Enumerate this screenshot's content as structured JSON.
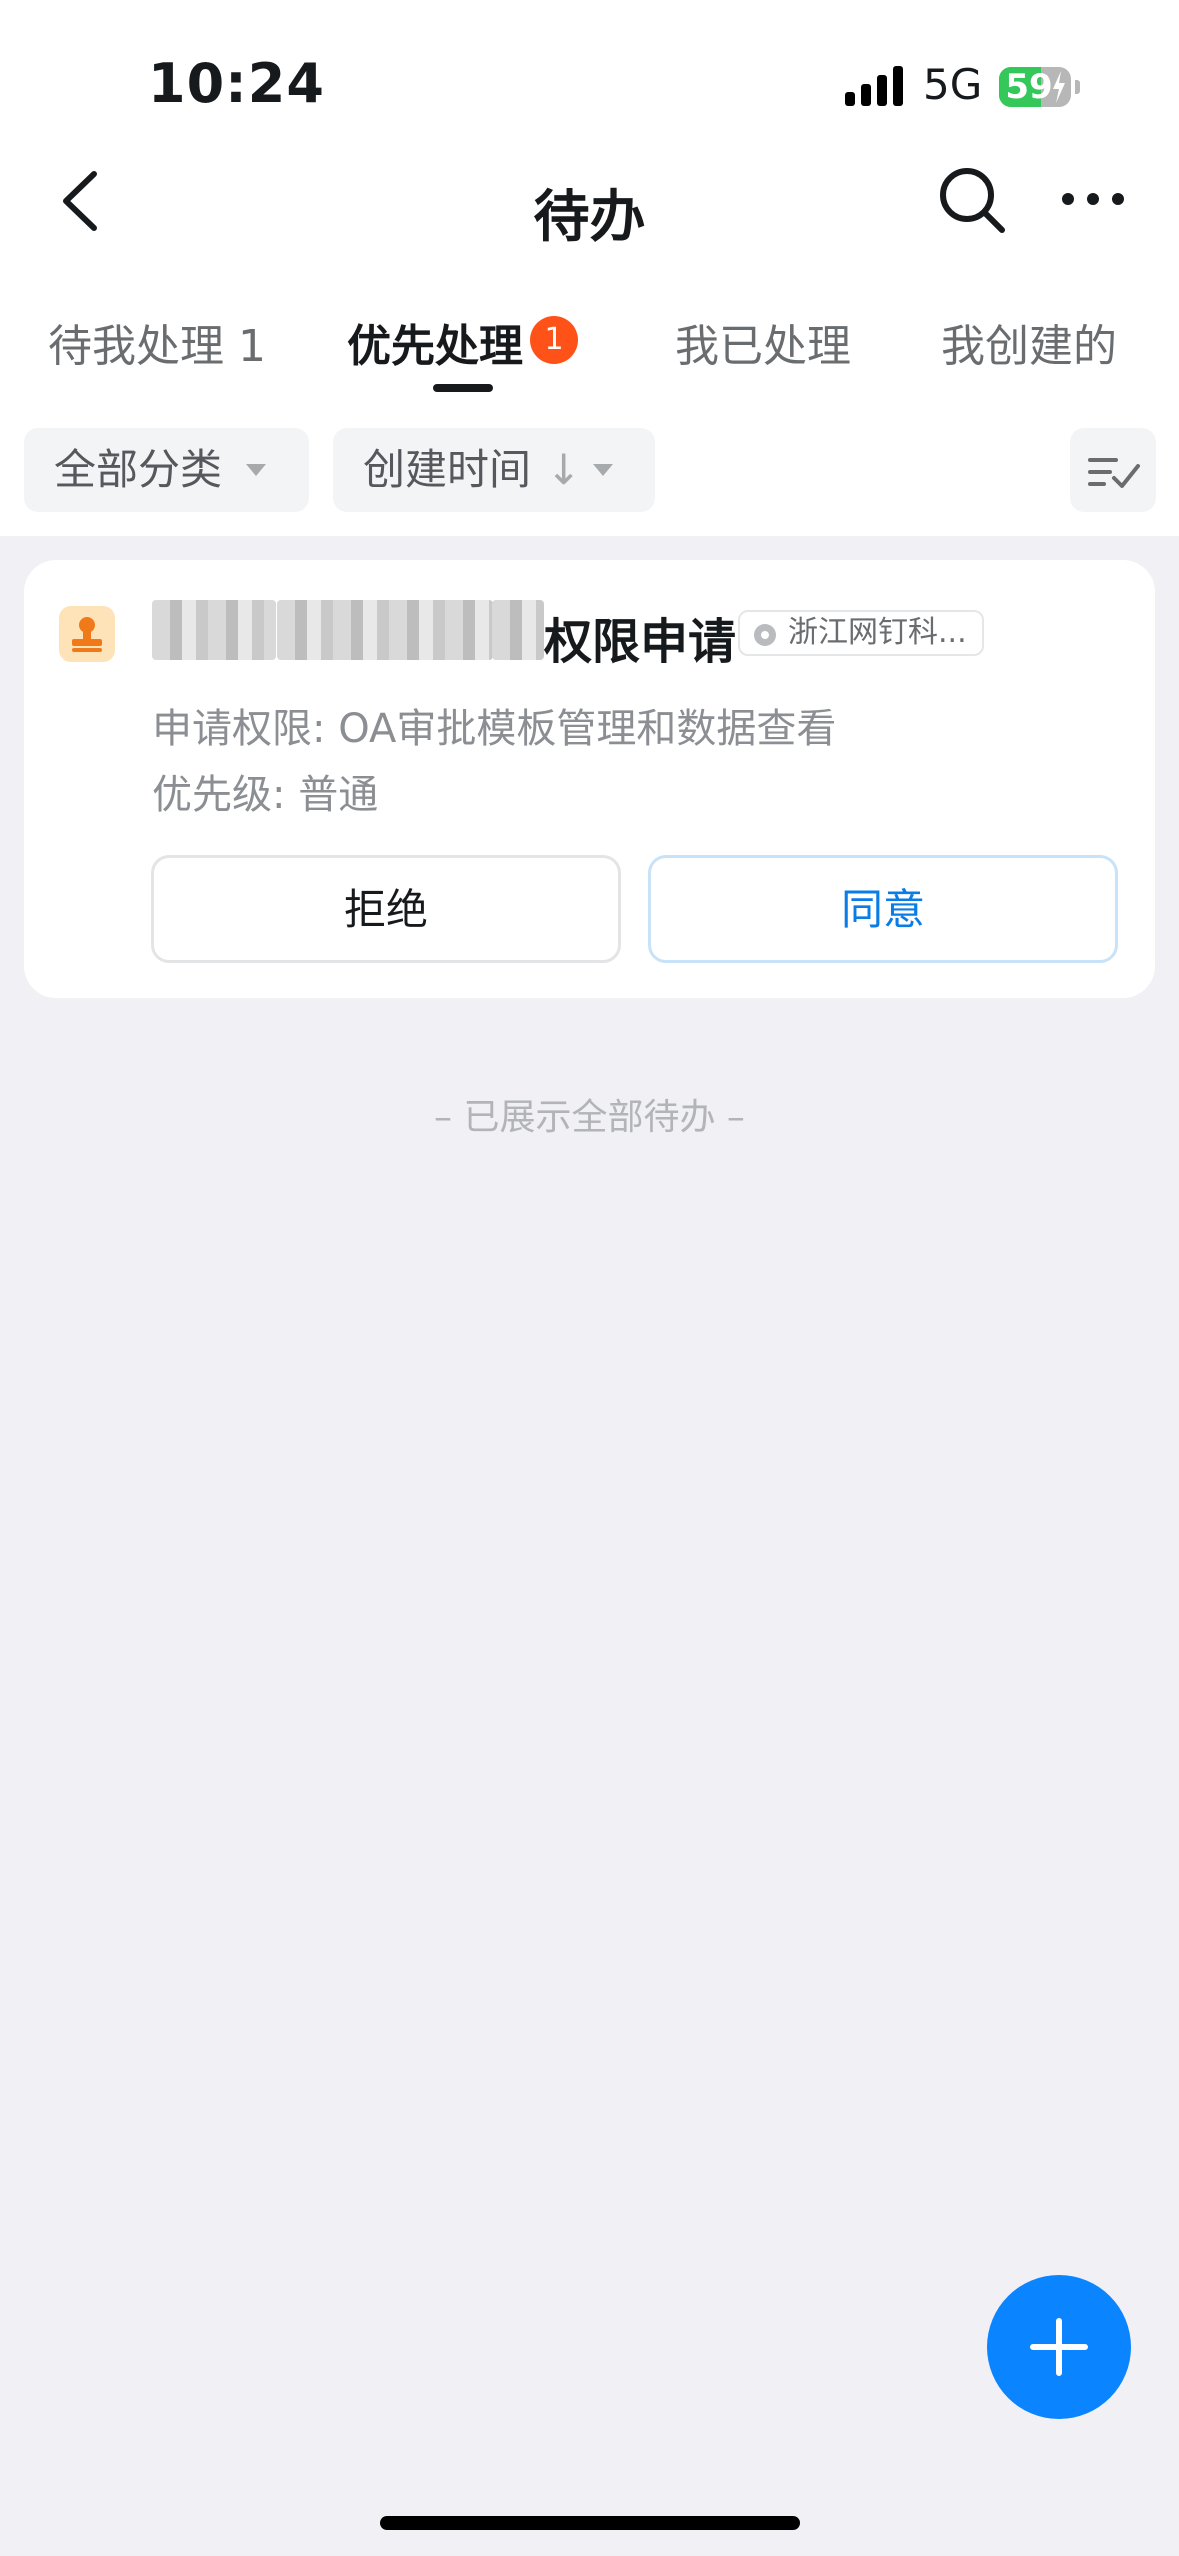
{
  "status_bar": {
    "time": "10:24",
    "network": "5G",
    "battery_percent": "59",
    "battery_level": 0.59
  },
  "nav": {
    "title": "待办"
  },
  "tabs": [
    {
      "label": "待我处理 1"
    },
    {
      "label": "优先处理",
      "badge": "1"
    },
    {
      "label": "我已处理"
    },
    {
      "label": "我创建的"
    }
  ],
  "filters": {
    "category": "全部分类",
    "sort": "创建时间",
    "sort_arrow": "↓"
  },
  "card": {
    "title_suffix": "权限申请",
    "org": "浙江网钉科...",
    "permission_line": "申请权限: OA审批模板管理和数据查看",
    "priority_line": "优先级: 普通",
    "reject_label": "拒绝",
    "agree_label": "同意"
  },
  "footer": {
    "note": "– 已展示全部待办 –"
  },
  "colors": {
    "accent": "#0a84ff",
    "badge": "#ff5219",
    "agree_text": "#0a7ce6"
  },
  "icons": [
    "back-chevron-icon",
    "search-icon",
    "more-icon",
    "sort-check-icon",
    "stamp-icon",
    "verified-gear-icon",
    "plus-icon"
  ]
}
